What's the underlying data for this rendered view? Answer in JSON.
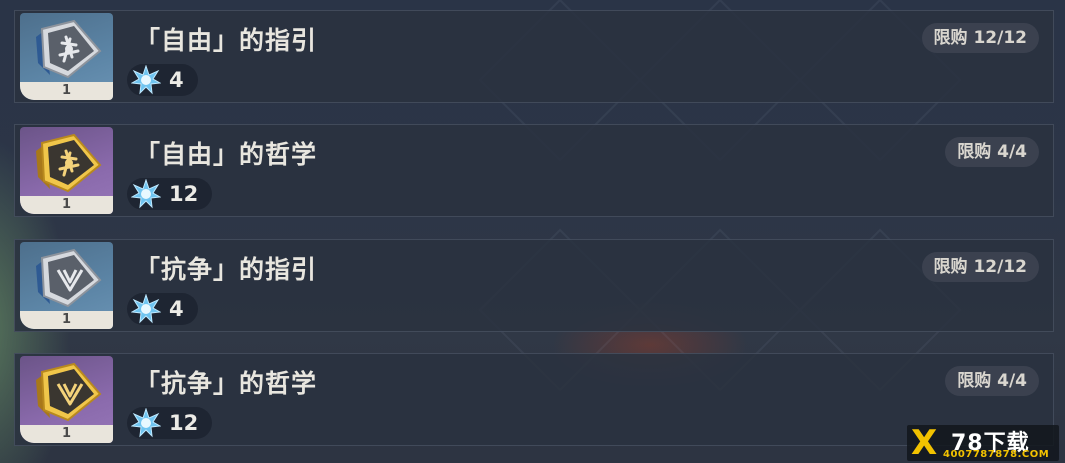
{
  "shop_items": [
    {
      "name": "「自由」的指引",
      "rarity_color": "#5c85a6",
      "book_icon": "freedom-guide-book-icon",
      "count": "1",
      "price": "4",
      "currency_icon": "starglitter-icon",
      "limit": "限购 12/12"
    },
    {
      "name": "「自由」的哲学",
      "rarity_color": "#8a6aac",
      "book_icon": "freedom-philosophy-book-icon",
      "count": "1",
      "price": "12",
      "currency_icon": "starglitter-icon",
      "limit": "限购 4/4"
    },
    {
      "name": "「抗争」的指引",
      "rarity_color": "#5c85a6",
      "book_icon": "resistance-guide-book-icon",
      "count": "1",
      "price": "4",
      "currency_icon": "starglitter-icon",
      "limit": "限购 12/12"
    },
    {
      "name": "「抗争」的哲学",
      "rarity_color": "#8a6aac",
      "book_icon": "resistance-philosophy-book-icon",
      "count": "1",
      "price": "12",
      "currency_icon": "starglitter-icon",
      "limit": "限购 4/4"
    }
  ],
  "watermark": {
    "mark": "X",
    "title": "78下载",
    "subtitle": "4007787878.COM"
  }
}
